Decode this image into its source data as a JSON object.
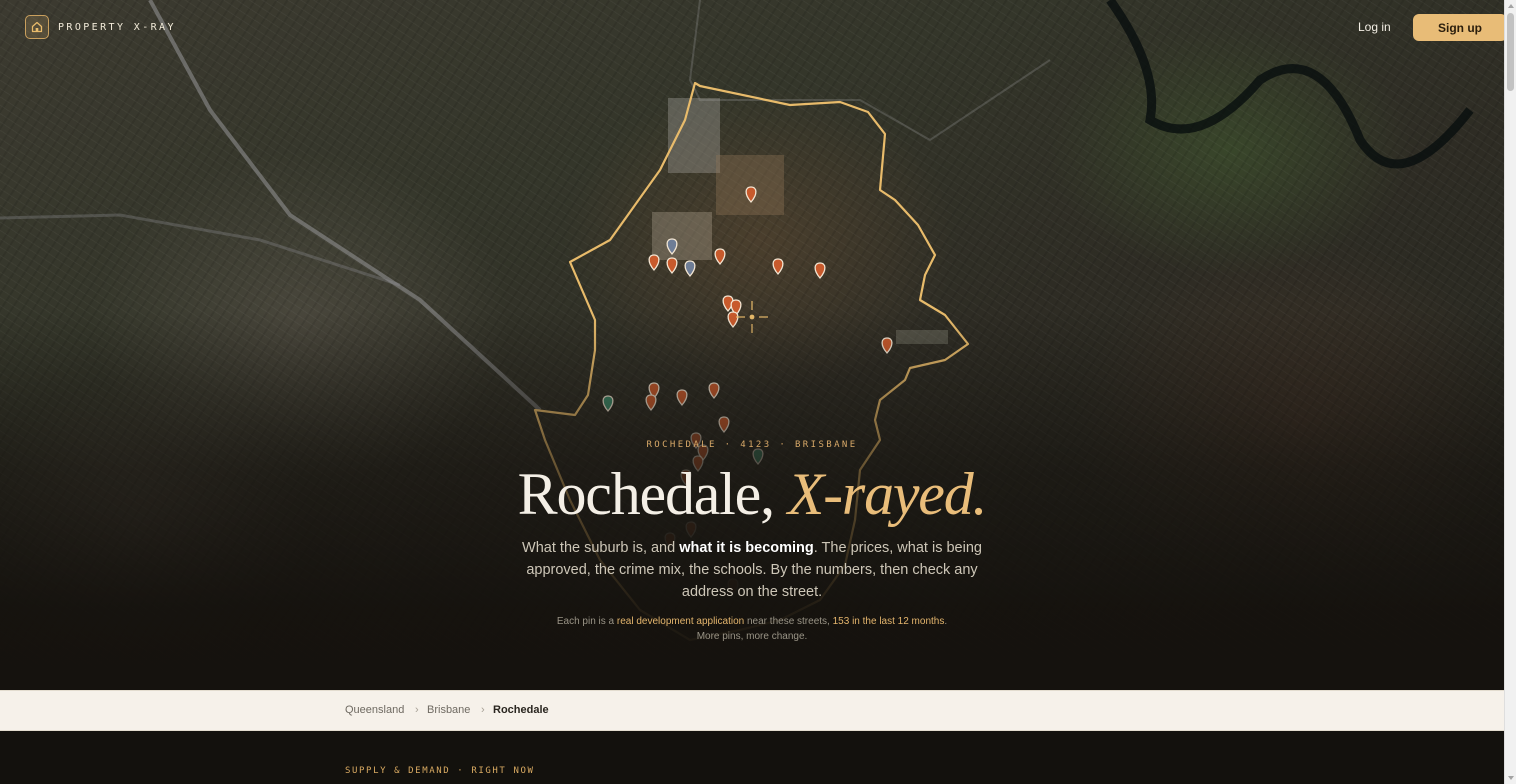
{
  "brand": {
    "name": "PROPERTY X-RAY",
    "logo_icon": "house-icon"
  },
  "nav": {
    "login_label": "Log in",
    "signup_label": "Sign up"
  },
  "hero": {
    "eyebrow": "ROCHEDALE · 4123 · BRISBANE",
    "title_main": "Rochedale,",
    "title_accent": "X-rayed.",
    "lead_part1": "What the suburb is, and ",
    "lead_bold": "what it is becoming",
    "lead_part2": ". The prices, what is being approved, the crime mix, the schools. By the numbers, then check any address on the street.",
    "note_part1": "Each pin is a ",
    "note_highlight1": "real development application",
    "note_part2": " near these streets, ",
    "note_highlight2": "153 in the last 12 months",
    "note_part3": ".",
    "note_line2": "More pins, more change."
  },
  "map": {
    "background": "satellite-imagery",
    "boundary_color": "#e8bb6b",
    "pin_colors": {
      "orange": "#c85a2c",
      "slate": "#6e7d96",
      "green": "#3f8a6a"
    },
    "crosshair_icon": "crosshair-icon"
  },
  "breadcrumb": {
    "items": [
      "Queensland",
      "Brisbane",
      "Rochedale"
    ],
    "separator": "›"
  },
  "section": {
    "eyebrow": "SUPPLY & DEMAND · RIGHT NOW"
  },
  "colors": {
    "accent": "#e8bc77",
    "accent_text": "#e9bd7a",
    "dark_bg": "#14110d",
    "crumb_bg": "#f6f1ea"
  }
}
